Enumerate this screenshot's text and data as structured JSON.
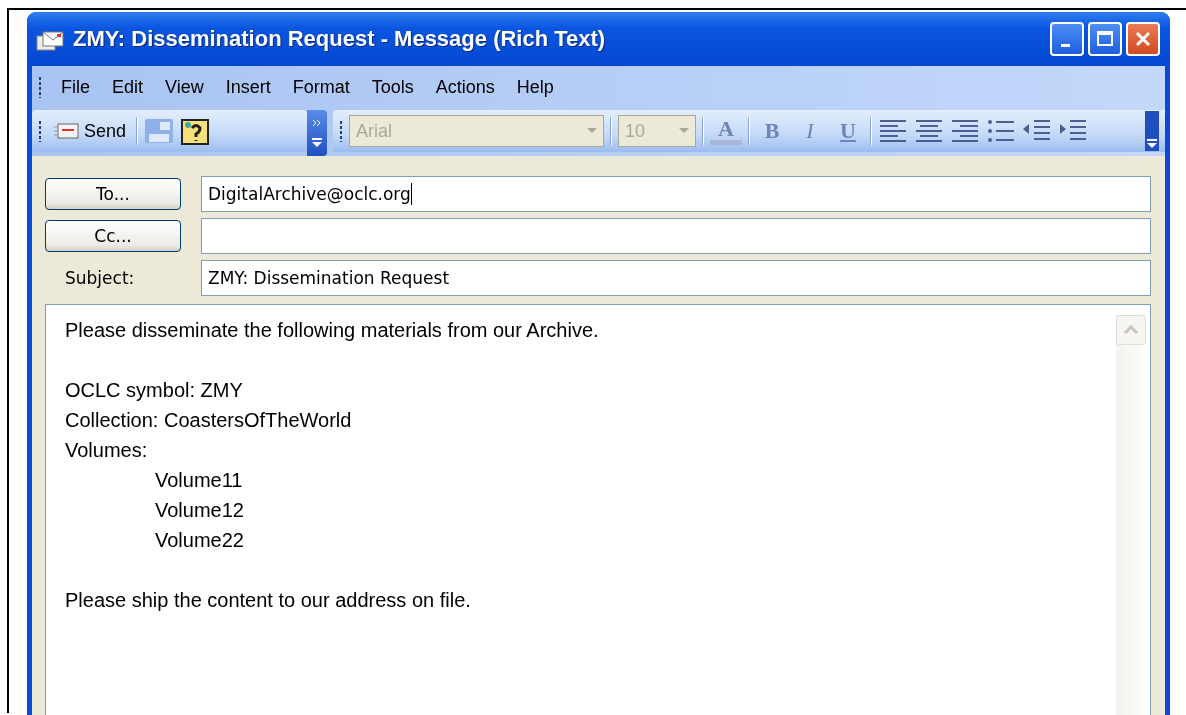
{
  "window": {
    "title": "ZMY: Dissemination Request - Message (Rich Text)"
  },
  "menu": [
    "File",
    "Edit",
    "View",
    "Insert",
    "Format",
    "Tools",
    "Actions",
    "Help"
  ],
  "toolbar": {
    "send": "Send",
    "font": {
      "value": "Arial",
      "disabled": true
    },
    "size": {
      "value": "10",
      "disabled": true
    },
    "format_buttons": [
      {
        "kind": "color",
        "label": "A",
        "disabled": true
      },
      {
        "kind": "bold",
        "label": "B",
        "disabled": true
      },
      {
        "kind": "italic",
        "label": "I",
        "disabled": true
      },
      {
        "kind": "underline",
        "label": "U",
        "disabled": true
      }
    ]
  },
  "fields": [
    {
      "kind": "button",
      "label": "To...",
      "value": "DigitalArchive@oclc.org",
      "focused": true
    },
    {
      "kind": "button",
      "label": "Cc...",
      "focused": false
    },
    {
      "kind": "label",
      "label": "Subject:",
      "value": "ZMY: Dissemination Request",
      "focused": false
    }
  ],
  "body": [
    {
      "lines": [
        {
          "text": "Please disseminate the following materials from our Archive."
        }
      ]
    },
    {
      "lines": [
        {
          "text": "OCLC symbol: ZMY"
        },
        {
          "text": "Collection: CoastersOfTheWorld"
        },
        {
          "text": "Volumes:",
          "children": [
            {
              "text": "Volume11"
            },
            {
              "text": "Volume12"
            },
            {
              "text": "Volume22"
            }
          ]
        }
      ]
    },
    {
      "lines": [
        {
          "text": "Please ship the content to our address on file."
        }
      ]
    }
  ]
}
